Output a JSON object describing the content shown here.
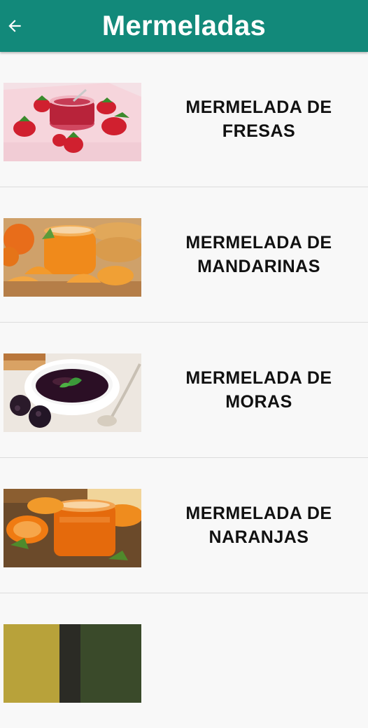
{
  "appbar": {
    "title": "Mermeladas",
    "color": "#12897a",
    "back_icon": "arrow-left-icon"
  },
  "items": [
    {
      "line1": "MERMELADA DE",
      "line2": "FRESAS",
      "image": "strawberry-jam"
    },
    {
      "line1": "MERMELADA DE",
      "line2": "MANDARINAS",
      "image": "tangerine-jam"
    },
    {
      "line1": "MERMELADA DE",
      "line2": "MORAS",
      "image": "blackberry-jam"
    },
    {
      "line1": "MERMELADA DE",
      "line2": "NARANJAS",
      "image": "orange-jam"
    }
  ]
}
